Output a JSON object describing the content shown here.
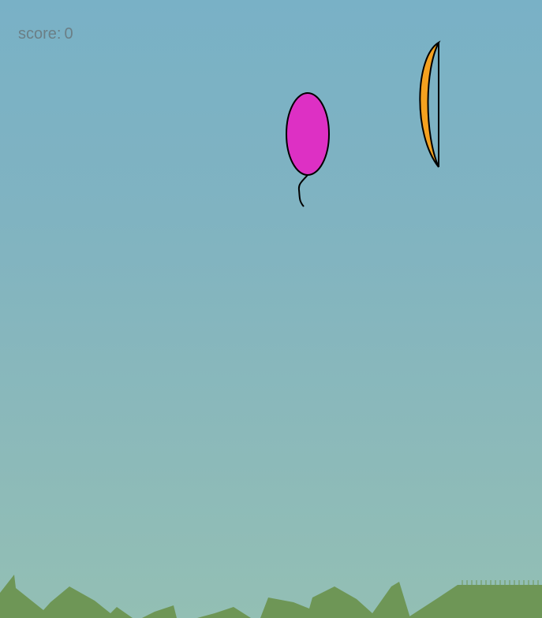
{
  "hud": {
    "score_label": "score:",
    "score_value": "0"
  },
  "colors": {
    "sky_top": "#79b1c6",
    "sky_bottom": "#93bfb4",
    "balloon": "#dd30c4",
    "bow": "#f4a11f",
    "grass": "#6e9656",
    "outline": "#000000"
  },
  "icons": {
    "balloon": "balloon-icon",
    "bow": "bow-icon",
    "grass": "grass-terrain"
  }
}
